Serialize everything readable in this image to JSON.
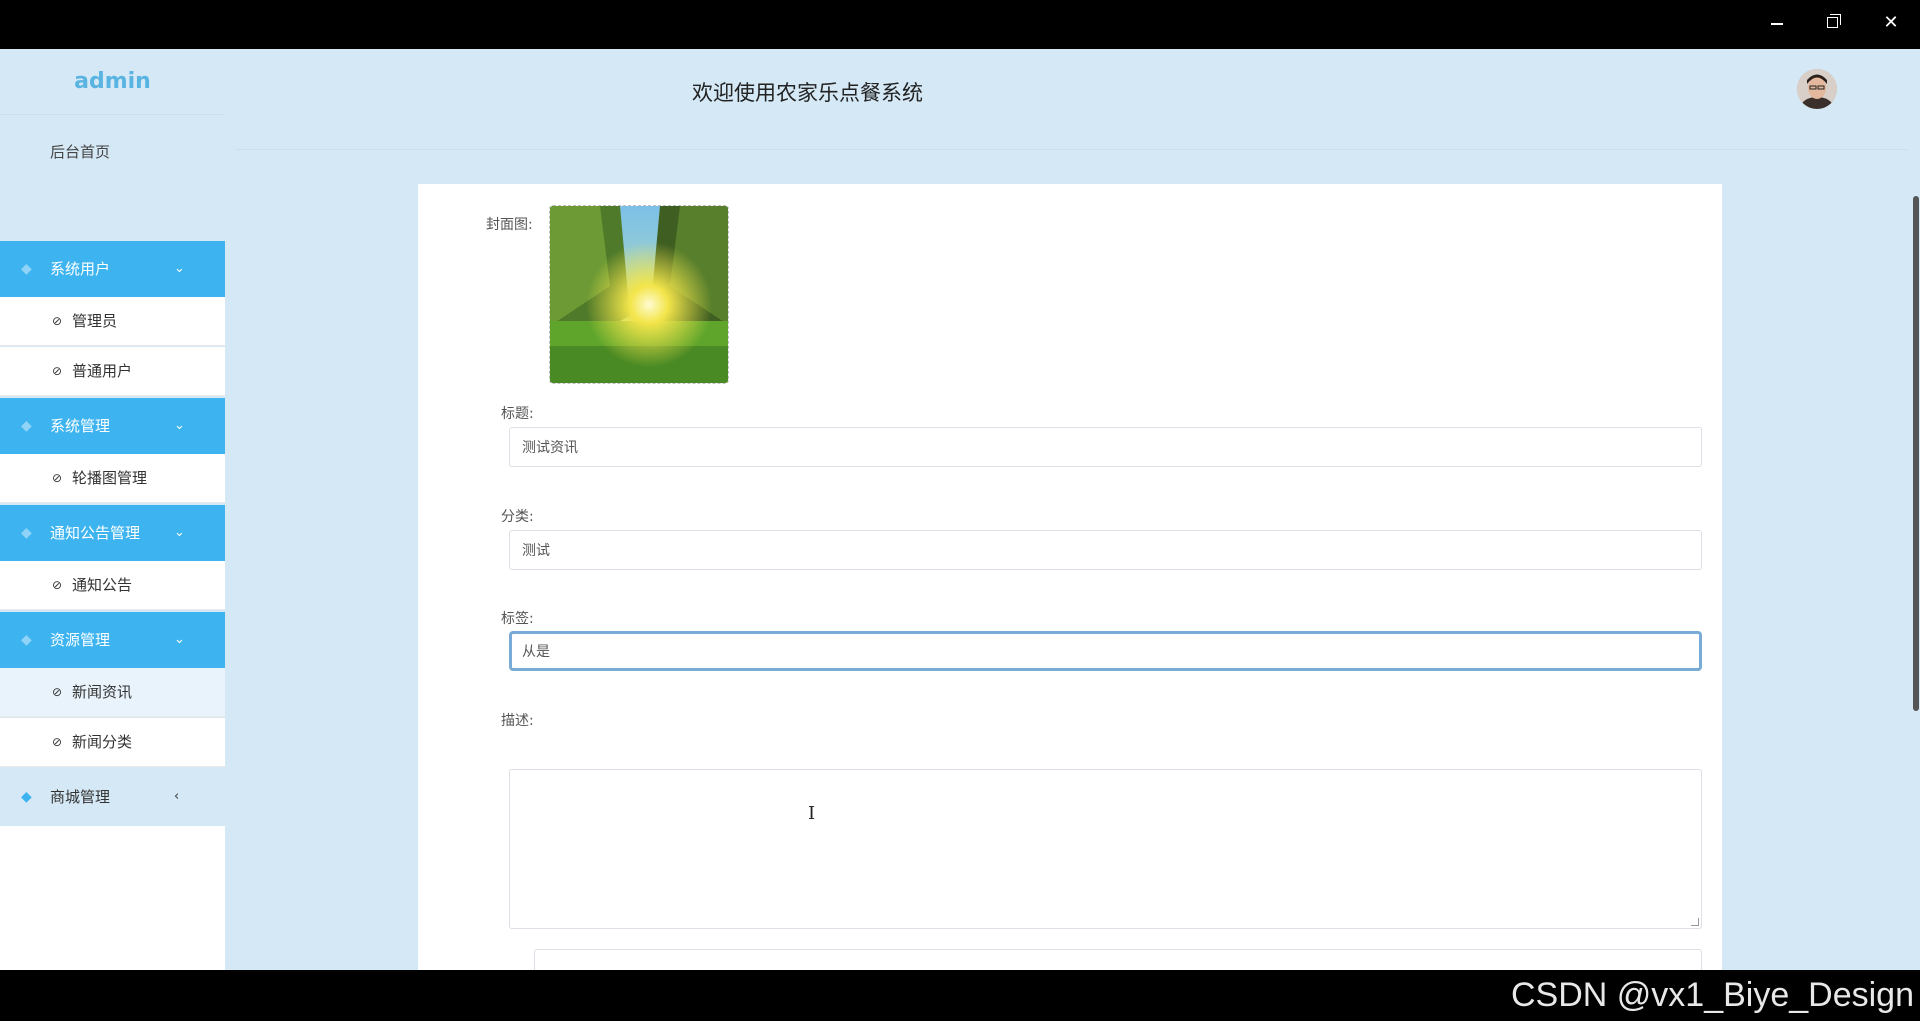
{
  "header": {
    "brand": "admin",
    "welcome": "欢迎使用农家乐点餐系统"
  },
  "sidebar": {
    "home": "后台首页",
    "groups": [
      {
        "label": "系统用户",
        "expanded": true,
        "items": [
          "管理员",
          "普通用户"
        ]
      },
      {
        "label": "系统管理",
        "expanded": true,
        "items": [
          "轮播图管理"
        ]
      },
      {
        "label": "通知公告管理",
        "expanded": true,
        "items": [
          "通知公告"
        ]
      },
      {
        "label": "资源管理",
        "expanded": true,
        "items": [
          "新闻资讯",
          "新闻分类"
        ]
      },
      {
        "label": "商城管理",
        "expanded": false,
        "items": []
      }
    ],
    "active_item": "新闻资讯"
  },
  "form": {
    "cover_label": "封面图:",
    "title_label": "标题:",
    "title_value": "测试资讯",
    "category_label": "分类:",
    "category_value": "测试",
    "tags_label": "标签:",
    "tags_value": "从是",
    "desc_label": "描述:",
    "desc_value": ""
  },
  "watermark": "CSDN @vx1_Biye_Design",
  "colors": {
    "accent": "#3db4f0",
    "background": "#d4e8f5",
    "brand": "#5ab4e2",
    "focus_border": "#79abd6"
  }
}
